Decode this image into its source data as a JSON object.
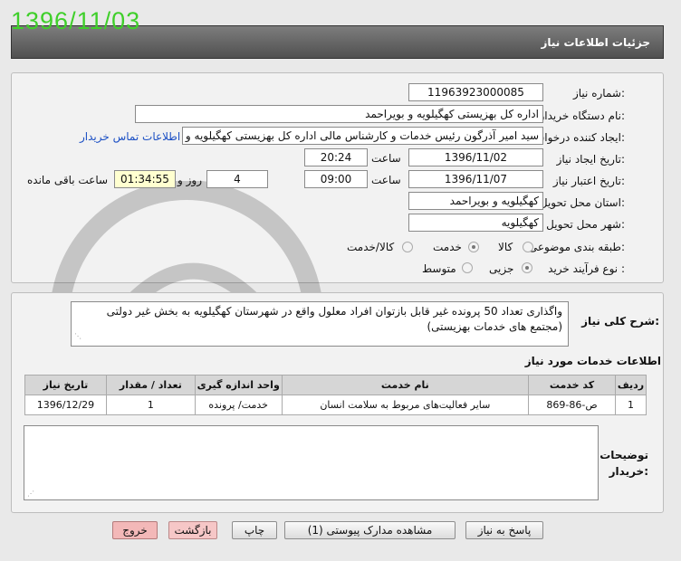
{
  "stamp": "1396/11/03",
  "header": {
    "title": "جزئیات اطلاعات نیاز"
  },
  "fields": {
    "need_no_label": "شماره نیاز:",
    "need_no": "11963923000085",
    "buyer_label": "نام دستگاه خریدار:",
    "buyer": "اداره کل بهزیستی کهگیلویه و بویراحمد",
    "creator_label": "ایجاد کننده درخواست:",
    "creator": "سید امیر آذرگون رئیس خدمات و کارشناس مالی اداره کل بهزیستی کهگیلویه و",
    "contact_link": "اطلاعات تماس خریدار",
    "created_label": "تاریخ ایجاد نیاز:",
    "created_date": "1396/11/02",
    "time_label": "ساعت",
    "created_time": "20:24",
    "valid_label": "تاریخ اعتبار نیاز:",
    "valid_date": "1396/11/07",
    "valid_time": "09:00",
    "days": "4",
    "days_label": "روز و",
    "remaining": "01:34:55",
    "remaining_label": "ساعت باقی مانده",
    "province_label": "استان محل تحویل:",
    "province": "کهگیلویه و بویراحمد",
    "city_label": "شهر محل تحویل:",
    "city": "کهگیلویه",
    "category_label": "طبقه بندی موضوعی:",
    "cat_goods": "کالا",
    "cat_service": "خدمت",
    "cat_both": "کالا/خدمت",
    "process_label": "نوع فرآیند خرید :",
    "proc_partial": "جزیی",
    "proc_medium": "متوسط"
  },
  "description": {
    "label": "شرح کلی نیاز:",
    "text": "واگذاری تعداد 50 پرونده غیر قابل بازتوان افراد معلول واقع در شهرستان کهگیلویه به بخش غیر دولتی (مجتمع های خدمات بهزیستی)"
  },
  "services": {
    "title": "اطلاعات خدمات مورد نیاز",
    "headers": [
      "ردیف",
      "کد خدمت",
      "نام خدمت",
      "واحد اندازه گیری",
      "تعداد / مقدار",
      "تاریخ نیاز"
    ],
    "rows": [
      [
        "1",
        "ص-86-869",
        "سایر فعالیت‌های مربوط به سلامت انسان",
        "خدمت/ پرونده",
        "1",
        "1396/12/29"
      ]
    ]
  },
  "notes": {
    "label1": "توضیحات",
    "label2": "خریدار:"
  },
  "buttons": {
    "reply": "پاسخ به نیاز",
    "attachments": "مشاهده مدارک پیوستی (1)",
    "print": "چاپ",
    "back": "بازگشت",
    "exit": "خروج"
  }
}
